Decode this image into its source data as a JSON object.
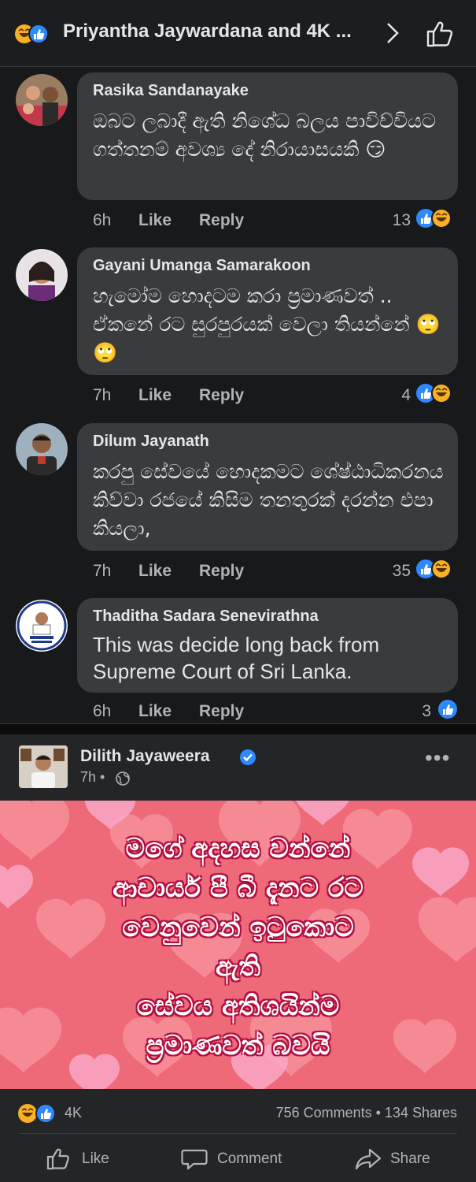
{
  "header": {
    "title": "Priyantha Jaywardana and 4K ...",
    "icons": [
      "haha-icon",
      "like-icon",
      "chevron-right-icon",
      "like-outline-icon"
    ]
  },
  "comments": [
    {
      "name": "Rasika Sandanayake",
      "text": "ඔබට ලබාදී ඇති නිශේධ බලය පාවිච්චියට ගත්තනම් අවශ්‍ය දේ නිරායාසයකි 😏",
      "time": "6h",
      "like": "Like",
      "reply": "Reply",
      "reaction_count": "13"
    },
    {
      "name": "Gayani Umanga Samarakoon",
      "text": "හැමෝම  හොදටම කරා ප්‍රමාණවත් .. ඒකනේ රට සුරපුරයක් වෙලා  තියන්නේ  🙄🙄",
      "time": "7h",
      "like": "Like",
      "reply": "Reply",
      "reaction_count": "4"
    },
    {
      "name": "Dilum Jayanath",
      "text": "කරපු සේවයේ හොදකමට ශේෂ්ඨාධිකරනය කිව්වා රජයේ කිසිම තනතුරක් දරන්න එපා කියලා,",
      "time": "7h",
      "like": "Like",
      "reply": "Reply",
      "reaction_count": "35"
    },
    {
      "name": "Thaditha Sadara Senevirathna",
      "text": "This was decide long back from Supreme Court of Sri Lanka.",
      "time": "6h",
      "like": "Like",
      "reply": "Reply",
      "reaction_count": "3"
    }
  ],
  "post": {
    "author": "Dilith Jayaweera",
    "time": "7h •",
    "more": "•••",
    "image_lines": [
      "මගේ අදහස වන්නේ",
      "ආචාර්ය පී බී දැනට රට",
      "වෙනුවෙන් ඉටුකොට",
      "ඇති",
      "සේවය අතිශයින්ම",
      "ප්‍රමාණවත් බවයි"
    ],
    "reaction_count": "4K",
    "stats": "756 Comments • 134 Shares",
    "actions": {
      "like": "Like",
      "comment": "Comment",
      "share": "Share"
    }
  },
  "colors": {
    "background": "#18191a",
    "bubble": "#3a3b3c",
    "text": "#e4e6eb",
    "muted": "#b0b3b8",
    "like_blue": "#2e89ff",
    "haha_yellow": "#f7b125",
    "image_pink": "#f06e7a"
  }
}
